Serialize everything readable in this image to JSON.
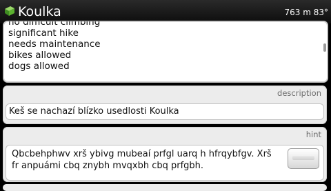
{
  "header": {
    "title": "Koulka",
    "status_readout": "763 m 83°",
    "icon": "cache-box-icon",
    "accent_color": "#5bb12f"
  },
  "attributes": {
    "items": [
      "no difficult climbing",
      "significant hike",
      "needs maintenance",
      "bikes allowed",
      "dogs allowed"
    ]
  },
  "description": {
    "label": "description",
    "text": "Keš se nachazí blízko usedlosti Koulka"
  },
  "hint": {
    "label": "hint",
    "text": "Qbcbehphwv xrš ybivg mubeaí prfgl uarq h hfrqybfgv. Xrš fr anpuámi cbq znybh mvqxbh cbq prfgbh.",
    "button_icon": "decode-hint-icon"
  }
}
